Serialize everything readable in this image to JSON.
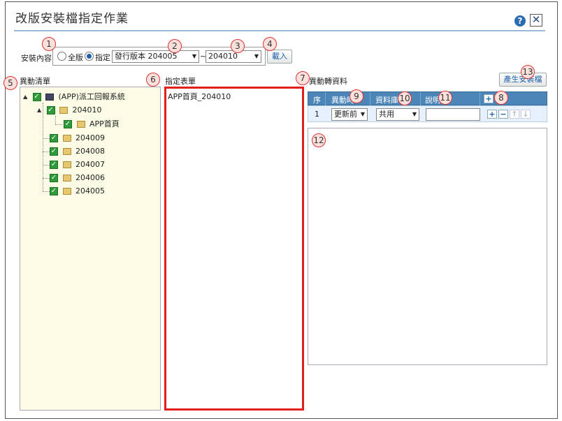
{
  "window": {
    "title": "改版安裝檔指定作業",
    "help": "?",
    "close": "✕"
  },
  "install": {
    "label": "安裝內容",
    "opt_full": "全版",
    "opt_specific": "指定",
    "version_from": "發行版本 204005",
    "tilde": "~",
    "version_to": "204010",
    "load_button": "載入"
  },
  "tree": {
    "title": "異動清單",
    "root": "(APP)派工回報系統",
    "nodes": [
      "204010",
      "APP首頁",
      "204009",
      "204008",
      "204007",
      "204006",
      "204005"
    ]
  },
  "form_list": {
    "title": "指定表單",
    "items": [
      "APP首頁_204010"
    ]
  },
  "change_data": {
    "title": "異動轉資料",
    "generate_button": "產生安裝檔",
    "columns": {
      "seq": "序",
      "type": "異動時",
      "db": "資料庫",
      "desc": "說明"
    },
    "add": "+",
    "row": {
      "seq": "1",
      "type": "更新前",
      "db": "共用",
      "desc": ""
    },
    "row_actions": {
      "add": "+",
      "remove": "−",
      "up": "↑",
      "down": "↓"
    }
  },
  "badges": [
    "1",
    "2",
    "3",
    "4",
    "5",
    "6",
    "7",
    "8",
    "9",
    "10",
    "11",
    "12",
    "13"
  ],
  "colors": {
    "accent": "#1e5fb0",
    "highlight": "#e0201c",
    "grid_header": "#4c86b8",
    "tree_bg": "#fcfce6",
    "badge": "#d33333"
  }
}
